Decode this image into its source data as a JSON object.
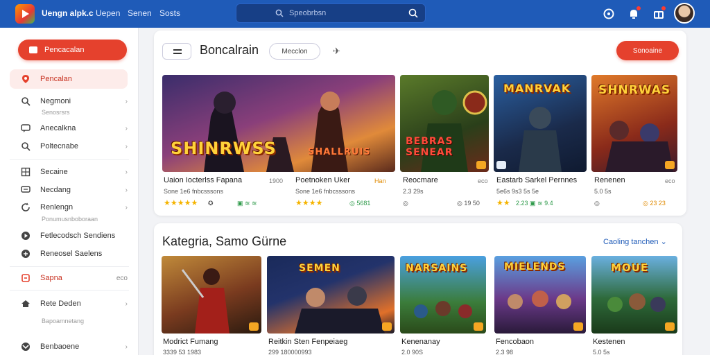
{
  "topbar": {
    "app_title": "Uengn alpk.c",
    "nav": [
      "Uepen",
      "Senen",
      "Sosts"
    ],
    "search_placeholder": "Speobrbsn"
  },
  "sidebar": {
    "primary_button": "Pencacalan",
    "items": [
      {
        "label": "Pencalan",
        "icon": "pin-icon",
        "active": true
      },
      {
        "label": "Negmoni",
        "sub": "Senosrsrs",
        "icon": "search-icon"
      },
      {
        "label": "Anecalkna",
        "icon": "chat-icon"
      },
      {
        "label": "Poltecnabe",
        "icon": "search-icon"
      },
      {
        "label": "Secaine",
        "icon": "grid-icon"
      },
      {
        "label": "Necdang",
        "icon": "chat-icon"
      },
      {
        "label": "Renlengn",
        "sub": "Ponumusnboboraan",
        "icon": "refresh-icon"
      },
      {
        "label": "Fetlecodsch Sendiens",
        "icon": "play-icon"
      },
      {
        "label": "Reneosel Saelens",
        "icon": "chat-icon"
      },
      {
        "label": "Sapna",
        "meta": "eco",
        "icon": "tag-icon"
      },
      {
        "label": "Rete Deden",
        "sub": "Bapoamnetang",
        "icon": "home-icon"
      },
      {
        "label": "Benbaoene",
        "icon": "user-icon"
      }
    ]
  },
  "featured": {
    "title": "Boncalrain",
    "pill": "Mecclon",
    "action_button": "Sonoaine",
    "games": [
      {
        "art": "SHINRWSS",
        "art2": "SHALLRUIS",
        "name": "Uaion Iocterlss Fapana",
        "meta": "1900",
        "sub": "Sone 1e6 fnbcsssons",
        "stars": "★★★★★",
        "icons": "✪",
        "color": "#6b3fa0"
      },
      {
        "art": "",
        "name": "Poetnoken Uker",
        "meta": "Han",
        "sub": "Sone 1e6 fnbcsssons",
        "stars": "★★★★",
        "icons": "◎ 5681",
        "color": "#b34a2a"
      },
      {
        "art": "BEBRAS SENEAR",
        "name": "Reocmare",
        "meta": "eco",
        "sub": "2.3 29s",
        "stars": "",
        "icons": "◎ 19 50",
        "color": "#3d6b2a"
      },
      {
        "art": "MANRVAK",
        "name": "Eastarb Sarkel Pernnes",
        "meta": "",
        "sub": "5e6s 9s3 5s 5e",
        "stars": "★★",
        "icons": "2.23 ▣ ≋ 9.4",
        "color": "#1f3f75"
      },
      {
        "art": "SHNRWAS",
        "name": "Renenen",
        "meta": "eco",
        "sub": "5.0 5s",
        "stars": "",
        "icons": "◎ 23 23",
        "color": "#8a3a1c"
      }
    ]
  },
  "categories": {
    "title": "Kategria, Samo Gürne",
    "link": "Caoling tanchen",
    "games": [
      {
        "art": "",
        "name": "Modrict Fumang",
        "sub": "3339 53 1983",
        "color": "#7a3b1f"
      },
      {
        "art": "SEMEN",
        "name": "Reitkin Sten Fenpeiaeg",
        "sub": "299 180000993",
        "color": "#23336b"
      },
      {
        "art": "NARSAINS",
        "name": "Kenenanay",
        "sub": "2.0 90S",
        "color": "#3b7c3a"
      },
      {
        "art": "MIELENDS",
        "name": "Fencobaon",
        "sub": "2.3 98",
        "color": "#6b3a8a"
      },
      {
        "art": "MOUE",
        "name": "Kestenen",
        "sub": "5.0 5s",
        "color": "#2e6a3a"
      }
    ]
  }
}
